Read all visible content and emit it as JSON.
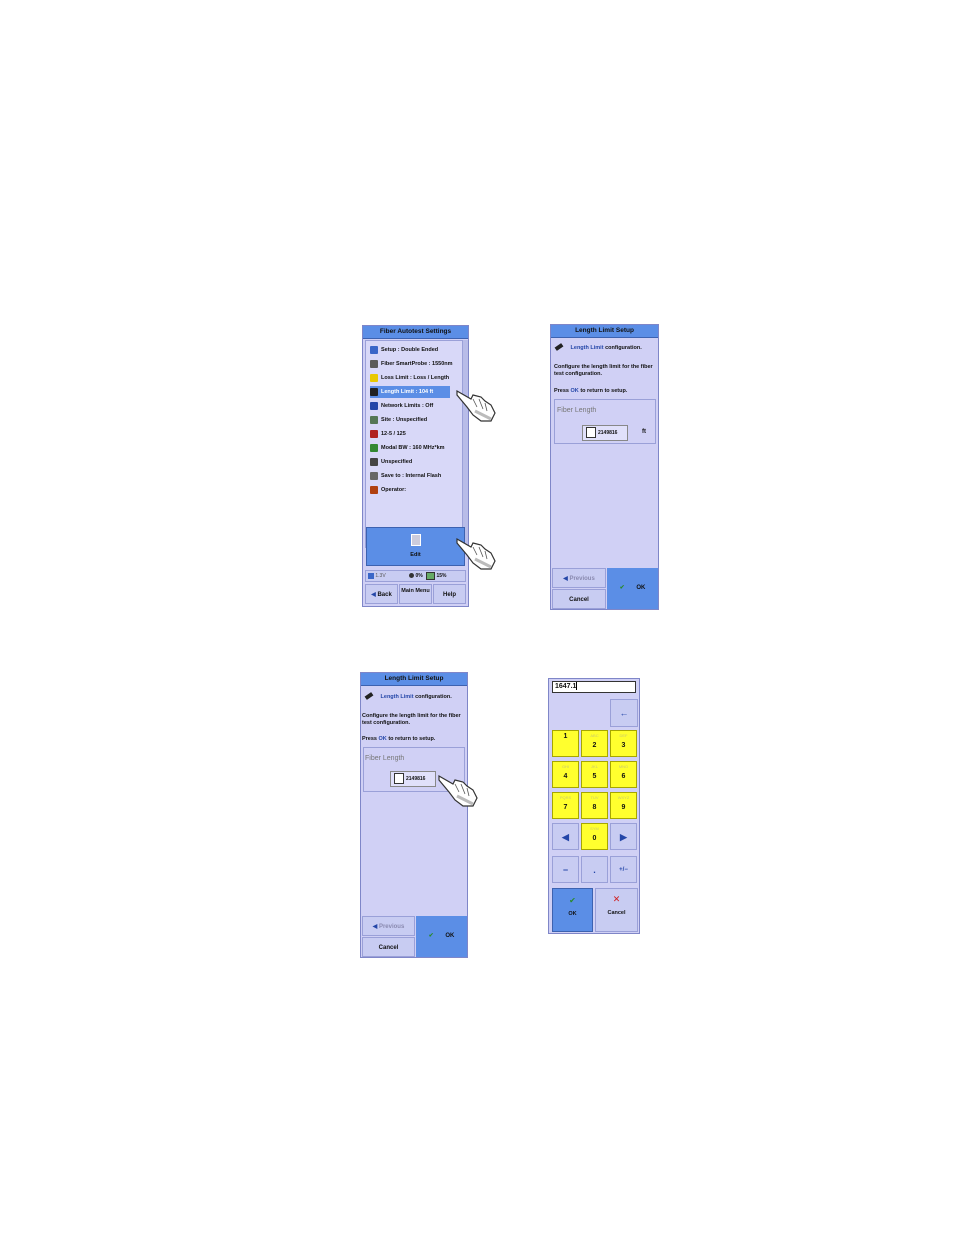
{
  "panel1": {
    "title": "Fiber Autotest Settings",
    "items": [
      {
        "label": "Setup : Double Ended",
        "icon": "setup-icon",
        "color": "#3a66c8"
      },
      {
        "label": "Fiber SmartProbe : 1550nm",
        "icon": "probe-icon",
        "color": "#5a5a5a"
      },
      {
        "label": "Loss Limit : Loss / Length",
        "icon": "loss-limit-icon",
        "color": "#e8c800"
      },
      {
        "label": "Length Limit : 104 ft",
        "icon": "length-limit-icon",
        "color": "#222222"
      },
      {
        "label": "Network Limits : Off",
        "icon": "network-icon",
        "color": "#2446a8"
      },
      {
        "label": "Site : Unspecified",
        "icon": "site-icon",
        "color": "#557755"
      },
      {
        "label": "12-5 / 125",
        "icon": "fiber-type-icon",
        "color": "#b02020"
      },
      {
        "label": "Modal BW : 160 MHz*km",
        "icon": "modal-icon",
        "color": "#338833"
      },
      {
        "label": "Unspecified",
        "icon": "doc-icon",
        "color": "#444444"
      },
      {
        "label": "Save to : Internal Flash",
        "icon": "save-icon",
        "color": "#666666"
      },
      {
        "label": "Operator:",
        "icon": "operator-icon",
        "color": "#b04010"
      }
    ],
    "edit_label": "Edit",
    "status_left": "1.3V",
    "status_mid": "0%",
    "status_right": "15%",
    "back_label": "Back",
    "main_menu_label": "Main Menu",
    "help_label": "Help"
  },
  "panel2": {
    "title": "Length Limit Setup",
    "intro_link": "Length Limit",
    "intro_rest": "configuration.",
    "instruction": "Configure the length limit for the fiber test configuration.",
    "press_pre": "Press",
    "press_ok": "OK",
    "press_post": "to return to setup.",
    "field_label": "Fiber Length",
    "field_value": "2149816",
    "unit": "ft",
    "previous_label": "Previous",
    "cancel_label": "Cancel",
    "ok_label": "OK"
  },
  "panel3": {
    "title": "Length Limit Setup",
    "intro_link": "Length Limit",
    "intro_rest": "configuration.",
    "instruction": "Configure the length limit for the fiber test configuration.",
    "press_pre": "Press",
    "press_ok": "OK",
    "press_post": "to return to setup.",
    "field_label": "Fiber Length",
    "field_value": "2149816",
    "previous_label": "Previous",
    "cancel_label": "Cancel",
    "ok_label": "OK"
  },
  "keypad": {
    "input_value": "1647.1",
    "backspace": "←",
    "keys": [
      {
        "main": "1",
        "sub": ""
      },
      {
        "main": "2",
        "sub": "ABC"
      },
      {
        "main": "3",
        "sub": "DEF"
      },
      {
        "main": "4",
        "sub": "GHI"
      },
      {
        "main": "5",
        "sub": "JKL"
      },
      {
        "main": "6",
        "sub": "MNO"
      },
      {
        "main": "7",
        "sub": "PQRS"
      },
      {
        "main": "8",
        "sub": "TUV"
      },
      {
        "main": "9",
        "sub": "WXYZ"
      },
      {
        "main": "0",
        "sub": "SYM"
      }
    ],
    "left": "◀",
    "right": "▶",
    "minus": "−",
    "dot": ".",
    "plusminus": "+/−",
    "ok_label": "OK",
    "cancel_label": "Cancel"
  },
  "colors": {
    "title_bar": "#5b8ee6",
    "panel_bg": "#d0d0f5",
    "key_yellow": "#ffff2e",
    "link_blue": "#2446a8",
    "cancel_red": "#d02020"
  }
}
